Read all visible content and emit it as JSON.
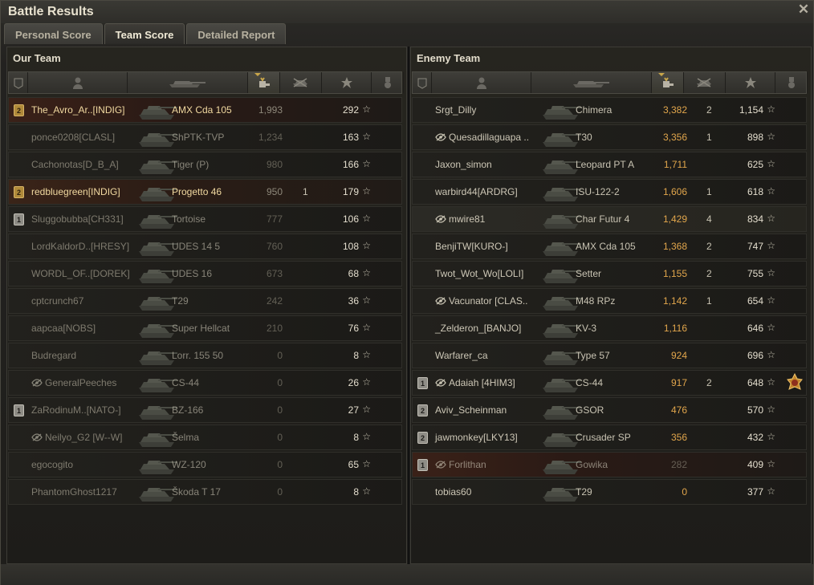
{
  "window": {
    "title": "Battle Results",
    "close_label": "✕"
  },
  "tabs": [
    {
      "label": "Personal Score",
      "active": false
    },
    {
      "label": "Team Score",
      "active": true
    },
    {
      "label": "Detailed Report",
      "active": false
    }
  ],
  "our_team": {
    "title": "Our Team",
    "rows": [
      {
        "badge": "2",
        "badge_type": "gold",
        "name": "The_Avro_Ar..[INDIG]",
        "hidden": false,
        "tank": "AMX Cda 105",
        "damage": "1,993",
        "kills": "",
        "xp": "292",
        "style": "mine",
        "name_style": "gold",
        "tank_style": "gold",
        "dead": false,
        "dmg_bright": false
      },
      {
        "badge": "",
        "name": "ponce0208[CLASL]",
        "hidden": false,
        "tank": "ShPTK-TVP",
        "damage": "1,234",
        "kills": "",
        "xp": "163",
        "style": "",
        "dead": true
      },
      {
        "badge": "",
        "name": "Cachonotas[D_B_A]",
        "hidden": false,
        "tank": "Tiger (P)",
        "damage": "980",
        "kills": "",
        "xp": "166",
        "style": "",
        "dead": true
      },
      {
        "badge": "2",
        "badge_type": "gold",
        "name": "redbluegreen[INDIG]",
        "hidden": false,
        "tank": "Progetto 46",
        "damage": "950",
        "kills": "1",
        "xp": "179",
        "style": "squad",
        "name_style": "gold",
        "tank_style": "gold",
        "dead": false
      },
      {
        "badge": "1",
        "badge_type": "silver",
        "name": "Sluggobubba[CH331]",
        "hidden": false,
        "tank": "Tortoise",
        "damage": "777",
        "kills": "",
        "xp": "106",
        "style": "",
        "dead": true
      },
      {
        "badge": "",
        "name": "LordKaldorD..[HRESY]",
        "hidden": false,
        "tank": "UDES 14 5",
        "damage": "760",
        "kills": "",
        "xp": "108",
        "style": "",
        "dead": true
      },
      {
        "badge": "",
        "name": "WORDL_OF..[DOREK]",
        "hidden": false,
        "tank": "UDES 16",
        "damage": "673",
        "kills": "",
        "xp": "68",
        "style": "",
        "dead": true
      },
      {
        "badge": "",
        "name": "cptcrunch67",
        "hidden": false,
        "tank": "T29",
        "damage": "242",
        "kills": "",
        "xp": "36",
        "style": "",
        "dead": true
      },
      {
        "badge": "",
        "name": "aapcaa[NOBS]",
        "hidden": false,
        "tank": "Super Hellcat",
        "damage": "210",
        "kills": "",
        "xp": "76",
        "style": "",
        "dead": true
      },
      {
        "badge": "",
        "name": "Budregard",
        "hidden": false,
        "tank": "Lorr. 155 50",
        "damage": "0",
        "kills": "",
        "xp": "8",
        "style": "",
        "dead": true
      },
      {
        "badge": "",
        "name": "GeneralPeeches",
        "hidden": true,
        "tank": "CS-44",
        "damage": "0",
        "kills": "",
        "xp": "26",
        "style": "",
        "dead": true
      },
      {
        "badge": "1",
        "badge_type": "silver",
        "name": "ZaRodinuM..[NATO-]",
        "hidden": false,
        "tank": "BZ-166",
        "damage": "0",
        "kills": "",
        "xp": "27",
        "style": "",
        "dead": true
      },
      {
        "badge": "",
        "name": "Neilyo_G2 [W--W]",
        "hidden": true,
        "tank": "Šelma",
        "damage": "0",
        "kills": "",
        "xp": "8",
        "style": "",
        "dead": true
      },
      {
        "badge": "",
        "name": "egocogito",
        "hidden": false,
        "tank": "WZ-120",
        "damage": "0",
        "kills": "",
        "xp": "65",
        "style": "",
        "dead": true
      },
      {
        "badge": "",
        "name": "PhantomGhost1217",
        "hidden": false,
        "tank": "Škoda T 17",
        "damage": "0",
        "kills": "",
        "xp": "8",
        "style": "",
        "dead": true
      }
    ]
  },
  "enemy_team": {
    "title": "Enemy Team",
    "rows": [
      {
        "badge": "",
        "name": "Srgt_Dilly",
        "hidden": false,
        "tank": "Chimera",
        "damage": "3,382",
        "kills": "2",
        "xp": "1,154",
        "dead": false
      },
      {
        "badge": "",
        "name": "Quesadillaguapa ..",
        "hidden": true,
        "tank": "T30",
        "damage": "3,356",
        "kills": "1",
        "xp": "898",
        "dead": false
      },
      {
        "badge": "",
        "name": "Jaxon_simon",
        "hidden": false,
        "tank": "Leopard PT A",
        "damage": "1,711",
        "kills": "",
        "xp": "625",
        "dead": false
      },
      {
        "badge": "",
        "name": "warbird44[ARDRG]",
        "hidden": false,
        "tank": "ISU-122-2",
        "damage": "1,606",
        "kills": "1",
        "xp": "618",
        "dead": false
      },
      {
        "badge": "",
        "name": "mwire81",
        "hidden": true,
        "tank": "Char Futur 4",
        "damage": "1,429",
        "kills": "4",
        "xp": "834",
        "dead": false,
        "style": "hl"
      },
      {
        "badge": "",
        "name": "BenjiTW[KURO-]",
        "hidden": false,
        "tank": "AMX Cda 105",
        "damage": "1,368",
        "kills": "2",
        "xp": "747",
        "dead": false
      },
      {
        "badge": "",
        "name": "Twot_Wot_Wo[LOLI]",
        "hidden": false,
        "tank": "Setter",
        "damage": "1,155",
        "kills": "2",
        "xp": "755",
        "dead": false
      },
      {
        "badge": "",
        "name": "Vacunator [CLAS..",
        "hidden": true,
        "tank": "M48 RPz",
        "damage": "1,142",
        "kills": "1",
        "xp": "654",
        "dead": false
      },
      {
        "badge": "",
        "name": "_Zelderon_[BANJO]",
        "hidden": false,
        "tank": "KV-3",
        "damage": "1,116",
        "kills": "",
        "xp": "646",
        "dead": false
      },
      {
        "badge": "",
        "name": "Warfarer_ca",
        "hidden": false,
        "tank": "Type 57",
        "damage": "924",
        "kills": "",
        "xp": "696",
        "dead": false
      },
      {
        "badge": "1",
        "badge_type": "silver",
        "name": "Adaiah [4HIM3]",
        "hidden": true,
        "tank": "CS-44",
        "damage": "917",
        "kills": "2",
        "xp": "648",
        "dead": false,
        "medal": true
      },
      {
        "badge": "2",
        "badge_type": "silver",
        "name": "Aviv_Scheinman",
        "hidden": false,
        "tank": "GSOR",
        "damage": "476",
        "kills": "",
        "xp": "570",
        "dead": false
      },
      {
        "badge": "2",
        "badge_type": "silver",
        "name": "jawmonkey[LKY13]",
        "hidden": false,
        "tank": "Crusader SP",
        "damage": "356",
        "kills": "",
        "xp": "432",
        "dead": false
      },
      {
        "badge": "1",
        "badge_type": "silver",
        "name": "Forlithan",
        "hidden": true,
        "tank": "Gowika",
        "damage": "282",
        "kills": "",
        "xp": "409",
        "dead": true,
        "style": "mine"
      },
      {
        "badge": "",
        "name": "tobias60",
        "hidden": false,
        "tank": "T29",
        "damage": "0",
        "kills": "",
        "xp": "377",
        "dead": false
      }
    ]
  },
  "columns": [
    "platoon-icon",
    "player-icon",
    "tank-icon",
    "damage-icon",
    "kills-icon",
    "xp-star-icon",
    "medal-icon"
  ],
  "colors": {
    "gold_text": "#f1d9a0",
    "damage_highlight": "#e2a64c",
    "background": "#1e1d1a"
  }
}
